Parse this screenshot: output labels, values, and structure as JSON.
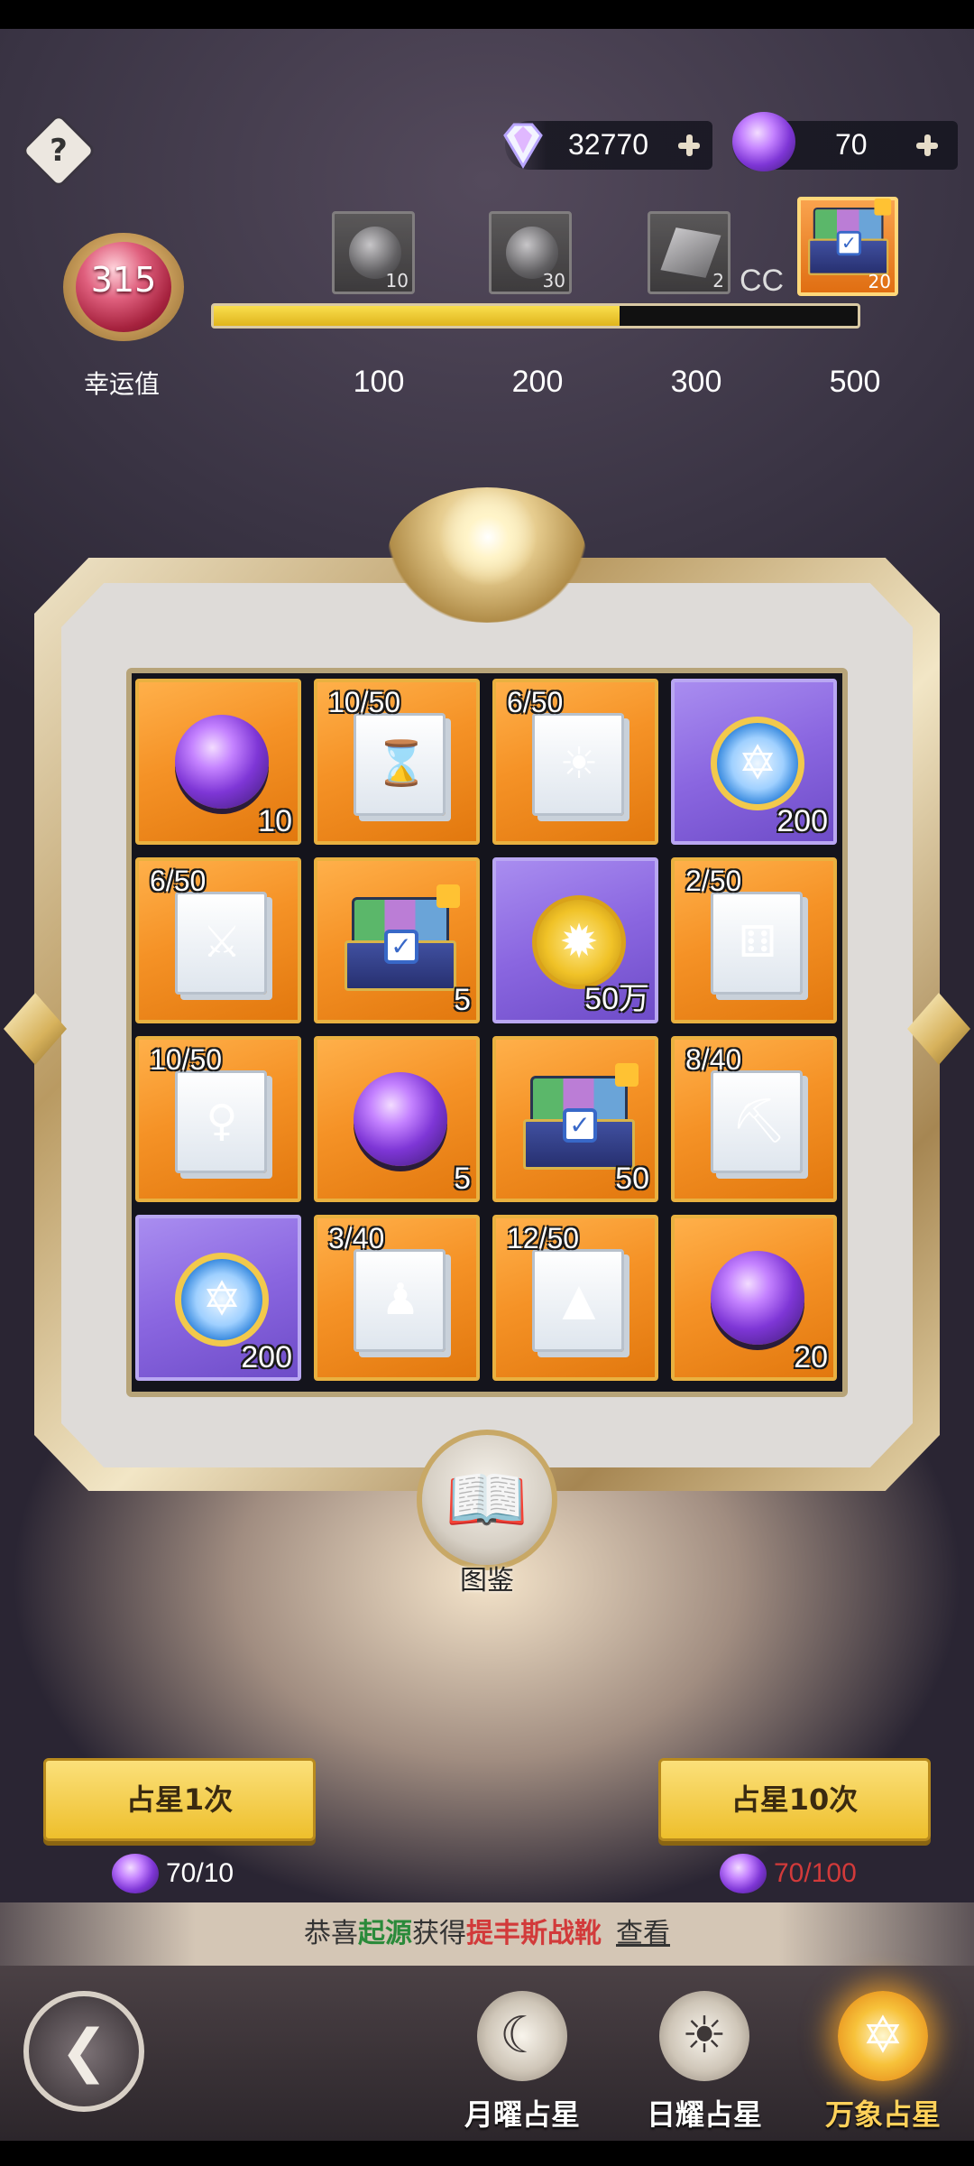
{
  "header": {
    "help_icon": "question-mark-icon",
    "help_label": "?",
    "diamond": {
      "icon": "diamond-icon",
      "value": "32770"
    },
    "orb": {
      "icon": "purple-orb-icon",
      "value": "70"
    }
  },
  "luck": {
    "value": "315",
    "label": "幸运值",
    "progress_fraction": 0.63,
    "milestones": [
      {
        "label": "100",
        "reward_count": "10",
        "reward_icon": "grey-orb-icon"
      },
      {
        "label": "200",
        "reward_count": "30",
        "reward_icon": "grey-orb-icon"
      },
      {
        "label": "300",
        "reward_count": "2",
        "reward_icon": "grey-cube-icon"
      },
      {
        "label": "500",
        "reward_count": "20",
        "reward_icon": "chest-icon"
      }
    ],
    "overflow_text": "CC"
  },
  "grid": {
    "cells": [
      {
        "type": "orb",
        "color": "orange",
        "count": "10",
        "frac": ""
      },
      {
        "type": "book",
        "color": "orange",
        "count": "",
        "frac": "10/50",
        "glyph": "⌛"
      },
      {
        "type": "book",
        "color": "orange",
        "count": "",
        "frac": "6/50",
        "glyph": "☀"
      },
      {
        "type": "medal",
        "color": "purple",
        "count": "200",
        "frac": ""
      },
      {
        "type": "book",
        "color": "orange",
        "count": "",
        "frac": "6/50",
        "glyph": "⚔"
      },
      {
        "type": "chest",
        "color": "orange",
        "count": "5",
        "frac": ""
      },
      {
        "type": "coin",
        "color": "purple",
        "count": "50万",
        "frac": ""
      },
      {
        "type": "book",
        "color": "orange",
        "count": "",
        "frac": "2/50",
        "glyph": "⚅"
      },
      {
        "type": "book",
        "color": "orange",
        "count": "",
        "frac": "10/50",
        "glyph": "♀"
      },
      {
        "type": "orb",
        "color": "orange",
        "count": "5",
        "frac": ""
      },
      {
        "type": "chest",
        "color": "orange",
        "count": "50",
        "frac": ""
      },
      {
        "type": "book",
        "color": "orange",
        "count": "",
        "frac": "8/40",
        "glyph": "⛏"
      },
      {
        "type": "medal",
        "color": "purple",
        "count": "200",
        "frac": ""
      },
      {
        "type": "book",
        "color": "orange",
        "count": "",
        "frac": "3/40",
        "glyph": "♟"
      },
      {
        "type": "book",
        "color": "orange",
        "count": "",
        "frac": "12/50",
        "glyph": "▲"
      },
      {
        "type": "orb",
        "color": "orange",
        "count": "20",
        "frac": ""
      }
    ]
  },
  "codex": {
    "label": "图鉴",
    "icon": "open-book-icon"
  },
  "draw": {
    "single": {
      "label": "占星1次",
      "cost": "70/10",
      "cost_color": "#ffffff"
    },
    "ten": {
      "label": "占星10次",
      "cost": "70/100",
      "cost_color": "#d23a3a"
    }
  },
  "notice": {
    "prefix": "恭喜",
    "player": "起源",
    "middle": "获得",
    "item": "提丰斯战靴",
    "link": "查看"
  },
  "nav": {
    "back_icon": "back-arrow-icon",
    "tabs": [
      {
        "label": "月曜占星",
        "icon": "moon-emblem-icon",
        "glyph": "☾",
        "active": false
      },
      {
        "label": "日耀占星",
        "icon": "sun-emblem-icon",
        "glyph": "☀",
        "active": false
      },
      {
        "label": "万象占星",
        "icon": "star-emblem-icon",
        "glyph": "✡",
        "active": true
      }
    ]
  }
}
